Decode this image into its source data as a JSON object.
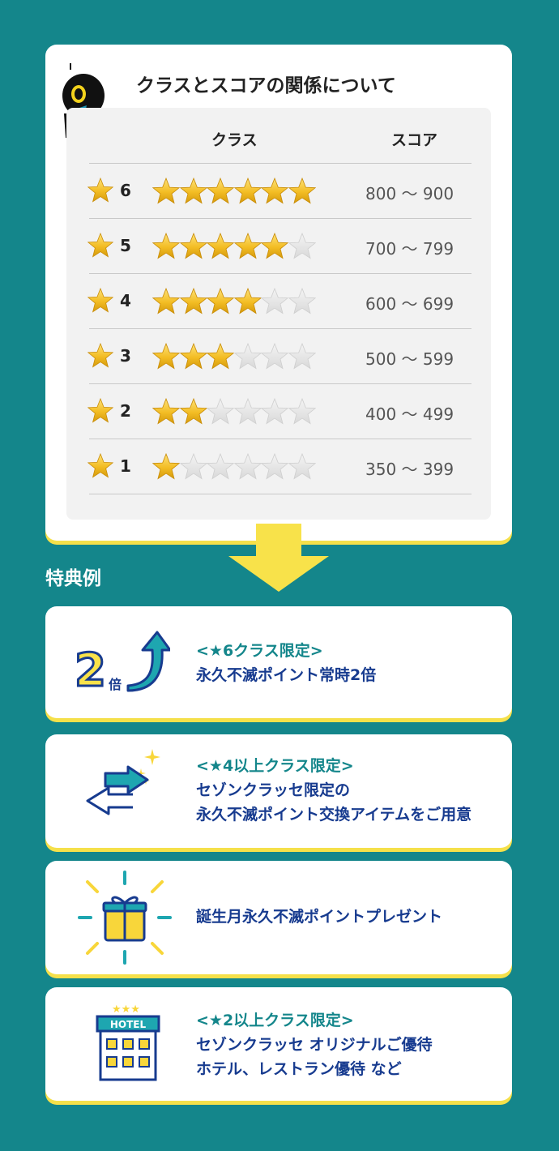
{
  "classes": {
    "title": "クラスとスコアの関係について",
    "header_class": "クラス",
    "header_score": "スコア",
    "rows": [
      {
        "num": "6",
        "filled": 6,
        "score": "800 〜 900"
      },
      {
        "num": "5",
        "filled": 5,
        "score": "700 〜 799"
      },
      {
        "num": "4",
        "filled": 4,
        "score": "600 〜 699"
      },
      {
        "num": "3",
        "filled": 3,
        "score": "500 〜 599"
      },
      {
        "num": "2",
        "filled": 2,
        "score": "400 〜 499"
      },
      {
        "num": "1",
        "filled": 1,
        "score": "350 〜 399"
      }
    ]
  },
  "benefits": {
    "title": "特典例",
    "items": [
      {
        "icon": "double-points-up-arrow-icon",
        "big": "2",
        "small": "倍",
        "tag": "<★6クラス限定>",
        "lines": [
          "永久不滅ポイント常時2倍"
        ]
      },
      {
        "icon": "exchange-arrows-icon",
        "tag": "<★4以上クラス限定>",
        "lines": [
          "セゾンクラッセ限定の",
          "永久不滅ポイント交換アイテムをご用意"
        ]
      },
      {
        "icon": "gift-box-icon",
        "tag": "",
        "lines": [
          "誕生月永久不滅ポイントプレゼント"
        ]
      },
      {
        "icon": "hotel-icon",
        "sign": "HOTEL",
        "tag": "<★2以上クラス限定>",
        "lines": [
          "セゾンクラッセ オリジナルご優待",
          "ホテル、レストラン優待 など"
        ]
      }
    ]
  },
  "colors": {
    "background": "#14868b",
    "star": "#f0b91a",
    "accent_yellow": "#f5e04a",
    "text_blue": "#173b8f",
    "text_teal": "#14868b"
  }
}
